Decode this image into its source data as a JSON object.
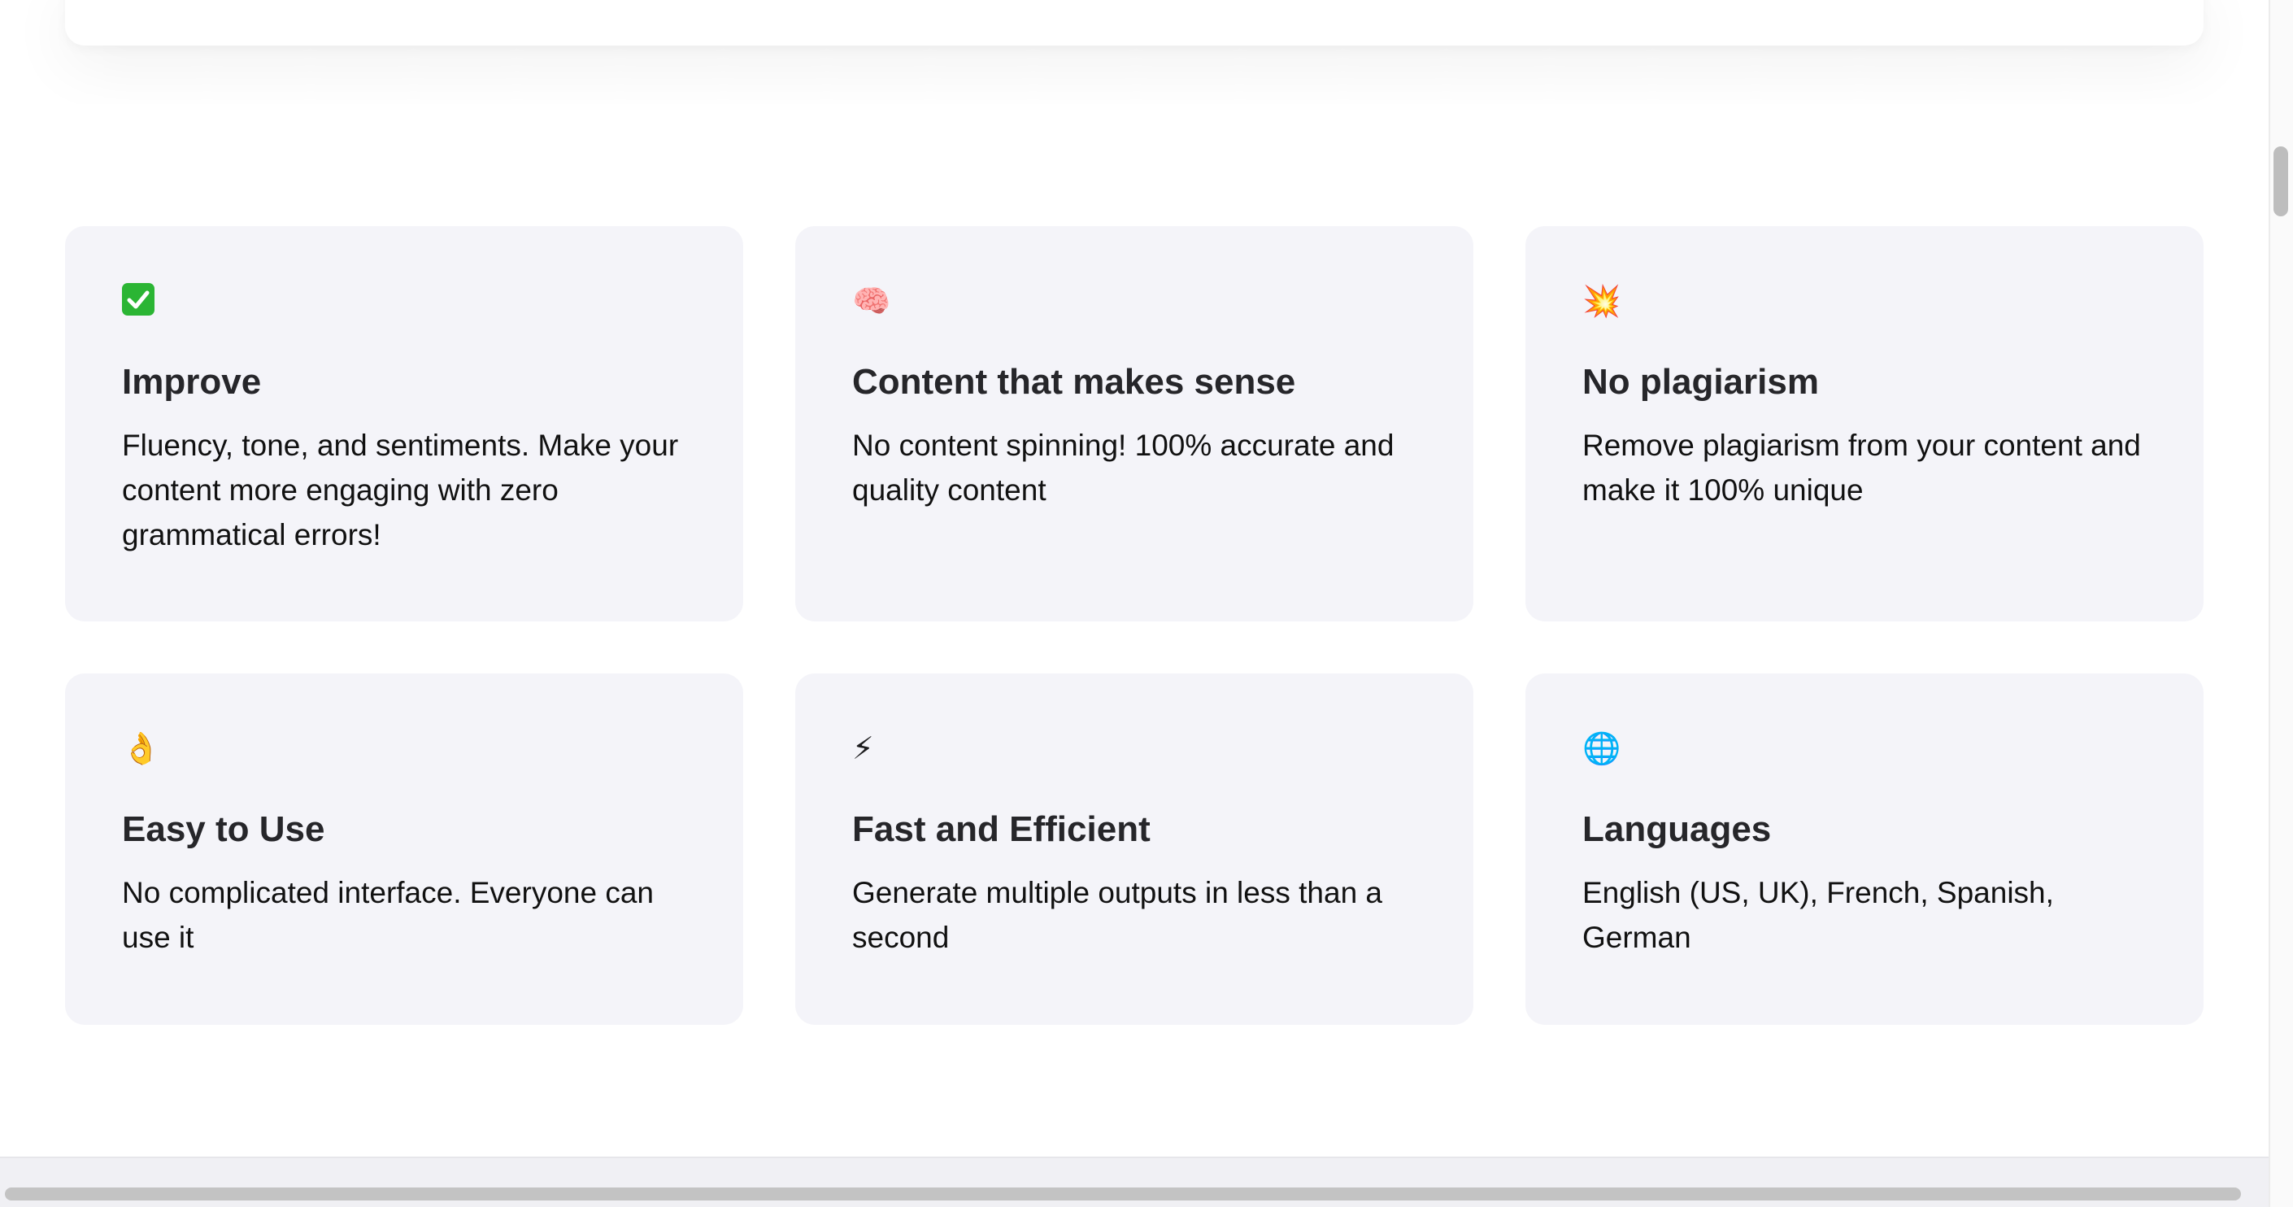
{
  "features": [
    {
      "icon": "check-mark-icon",
      "icon_glyph": "✅",
      "title": "Improve",
      "description": "Fluency, tone, and sentiments. Make your content more engaging with zero grammatical errors!"
    },
    {
      "icon": "brain-icon",
      "icon_glyph": "🧠",
      "title": "Content that makes sense",
      "description": "No content spinning! 100% accurate and quality content"
    },
    {
      "icon": "collision-icon",
      "icon_glyph": "💥",
      "title": "No plagiarism",
      "description": "Remove plagiarism from your content and make it 100% unique"
    },
    {
      "icon": "ok-hand-icon",
      "icon_glyph": "👌",
      "title": "Easy to Use",
      "description": "No complicated interface. Everyone can use it"
    },
    {
      "icon": "lightning-icon",
      "icon_glyph": "⚡",
      "title": "Fast and Efficient",
      "description": "Generate multiple outputs in less than a second"
    },
    {
      "icon": "globe-icon",
      "icon_glyph": "🌐",
      "title": "Languages",
      "description": "English (US, UK), French, Spanish, German"
    }
  ],
  "colors": {
    "card_background": "#f4f4f9",
    "check_green": "#2bb534",
    "heading": "#26262a"
  }
}
